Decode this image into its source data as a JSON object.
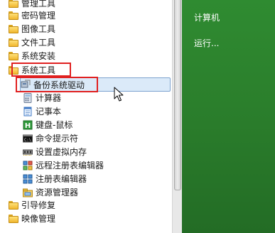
{
  "menu": {
    "folders_top": [
      {
        "label": "管理工具"
      },
      {
        "label": "密码管理"
      },
      {
        "label": "图像工具"
      },
      {
        "label": "文件工具"
      },
      {
        "label": "系统安装"
      },
      {
        "label": "系统工具"
      }
    ],
    "system_tools_items": [
      {
        "label": "备份系统驱动",
        "icon": "driver-backup-icon"
      },
      {
        "label": "计算器",
        "icon": "calculator-icon"
      },
      {
        "label": "记事本",
        "icon": "notepad-icon"
      },
      {
        "label": "键盘-鼠标",
        "icon": "keyboard-mouse-icon"
      },
      {
        "label": "命令提示符",
        "icon": "command-prompt-icon"
      },
      {
        "label": "设置虚拟内存",
        "icon": "memory-chip-icon"
      },
      {
        "label": "远程注册表编辑器",
        "icon": "remote-registry-icon"
      },
      {
        "label": "注册表编辑器",
        "icon": "registry-editor-icon"
      },
      {
        "label": "资源管理器",
        "icon": "explorer-icon"
      }
    ],
    "folders_bottom": [
      {
        "label": "引导修复"
      },
      {
        "label": "映像管理"
      }
    ]
  },
  "right_pane": {
    "computer_label": "计算机",
    "run_label": "运行..."
  },
  "colors": {
    "highlight_red": "#e02020",
    "green_panel": "#2b7f2c",
    "selection_blue": "#dbeaf9"
  }
}
